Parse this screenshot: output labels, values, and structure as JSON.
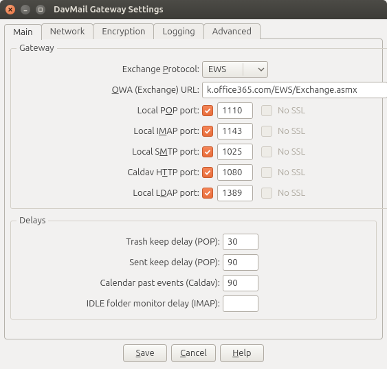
{
  "window": {
    "title": "DavMail Gateway Settings"
  },
  "tabs": {
    "main": "Main",
    "network": "Network",
    "encryption": "Encryption",
    "logging": "Logging",
    "advanced": "Advanced"
  },
  "gateway": {
    "legend": "Gateway",
    "exchange_protocol": {
      "label_pre": "Exchange ",
      "label_ak": "P",
      "label_post": "rotocol:",
      "value": "EWS"
    },
    "owa_url": {
      "label_pre": "",
      "label_ak": "O",
      "label_post": "WA (Exchange) URL:",
      "value": "k.office365.com/EWS/Exchange.asmx"
    },
    "pop": {
      "label_pre": "Local P",
      "label_ak": "O",
      "label_post": "P port:",
      "enabled": true,
      "port": "1110",
      "ssl": false,
      "ssl_label": "No SSL"
    },
    "imap": {
      "label_pre": "Local I",
      "label_ak": "M",
      "label_post": "AP port:",
      "enabled": true,
      "port": "1143",
      "ssl": false,
      "ssl_label": "No SSL"
    },
    "smtp": {
      "label_pre": "Local S",
      "label_ak": "M",
      "label_post": "TP port:",
      "enabled": true,
      "port": "1025",
      "ssl": false,
      "ssl_label": "No SSL"
    },
    "caldav": {
      "label_pre": "Caldav H",
      "label_ak": "T",
      "label_post": "TP port:",
      "enabled": true,
      "port": "1080",
      "ssl": false,
      "ssl_label": "No SSL"
    },
    "ldap": {
      "label_pre": "Local L",
      "label_ak": "D",
      "label_post": "AP port:",
      "enabled": true,
      "port": "1389",
      "ssl": false,
      "ssl_label": "No SSL"
    }
  },
  "delays": {
    "legend": "Delays",
    "trash": {
      "label": "Trash keep delay (POP):",
      "value": "30"
    },
    "sent": {
      "label": "Sent keep delay (POP):",
      "value": "90"
    },
    "calpast": {
      "label": "Calendar past events (Caldav):",
      "value": "90"
    },
    "idle": {
      "label": "IDLE folder monitor delay (IMAP):",
      "value": ""
    }
  },
  "buttons": {
    "save": {
      "ak": "S",
      "rest": "ave"
    },
    "cancel": {
      "ak": "C",
      "rest": "ancel"
    },
    "help": {
      "ak": "H",
      "rest": "elp"
    }
  }
}
